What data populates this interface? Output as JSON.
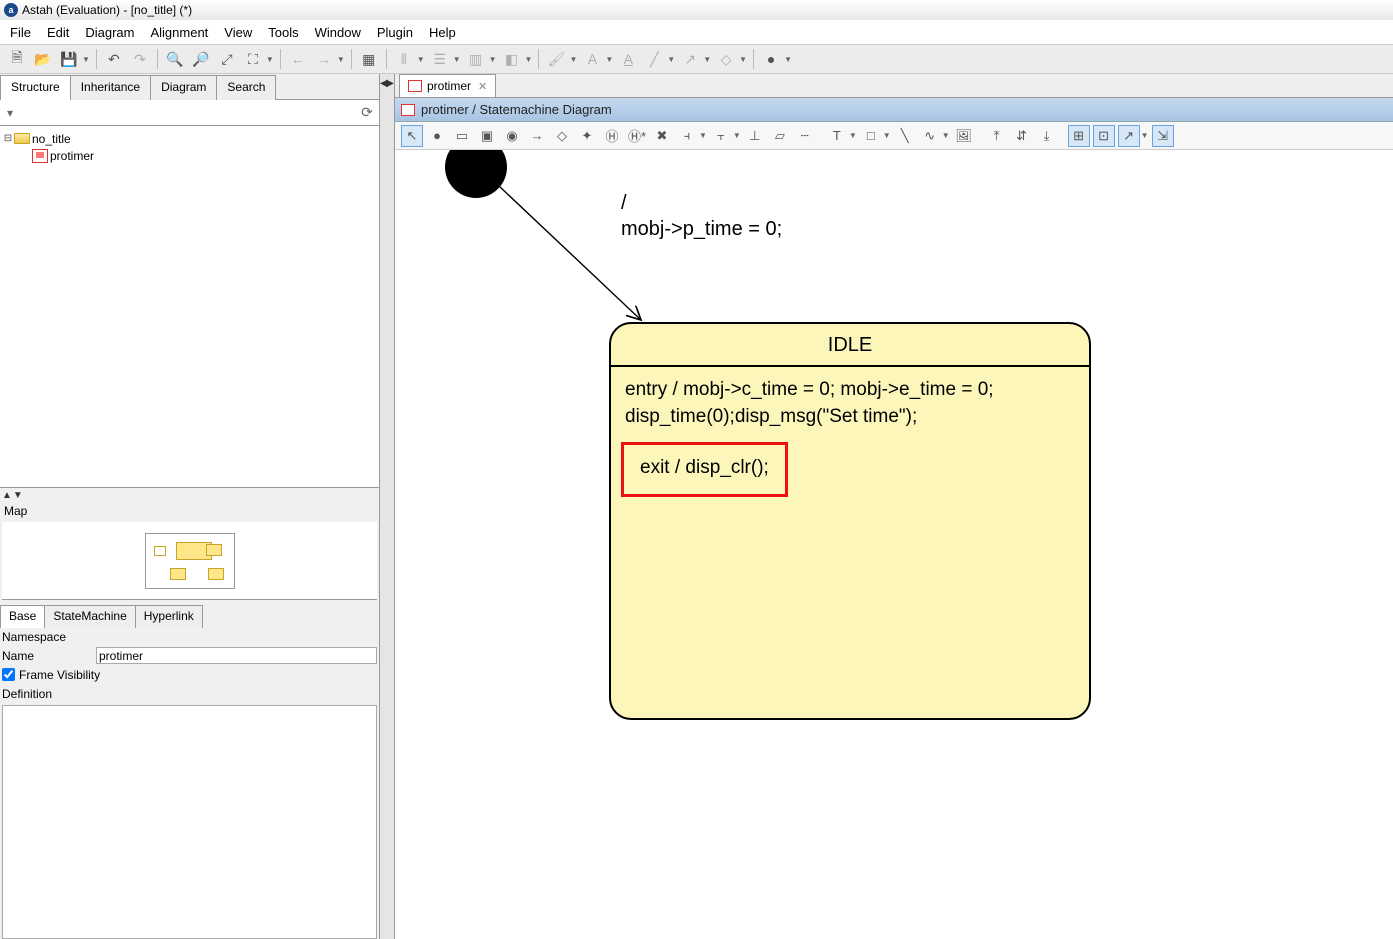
{
  "window": {
    "title": "Astah (Evaluation) - [no_title] (*)"
  },
  "menu": [
    "File",
    "Edit",
    "Diagram",
    "Alignment",
    "View",
    "Tools",
    "Window",
    "Plugin",
    "Help"
  ],
  "left_tabs": [
    "Structure",
    "Inheritance",
    "Diagram",
    "Search"
  ],
  "tree": {
    "root": "no_title",
    "child": "protimer"
  },
  "map_label": "Map",
  "prop_tabs": [
    "Base",
    "StateMachine",
    "Hyperlink"
  ],
  "props": {
    "namespace_label": "Namespace",
    "name_label": "Name",
    "name_value": "protimer",
    "frame_visibility_label": "Frame Visibility",
    "frame_visibility": true,
    "definition_label": "Definition"
  },
  "doc_tab": "protimer",
  "breadcrumb": "protimer / Statemachine Diagram",
  "transition_label_l1": "/",
  "transition_label_l2": "mobj->p_time = 0;",
  "state": {
    "name": "IDLE",
    "entry_l1": "entry / mobj->c_time = 0; mobj->e_time = 0;",
    "entry_l2": "disp_time(0);disp_msg(\"Set time\");",
    "exit": "exit / disp_clr();"
  }
}
